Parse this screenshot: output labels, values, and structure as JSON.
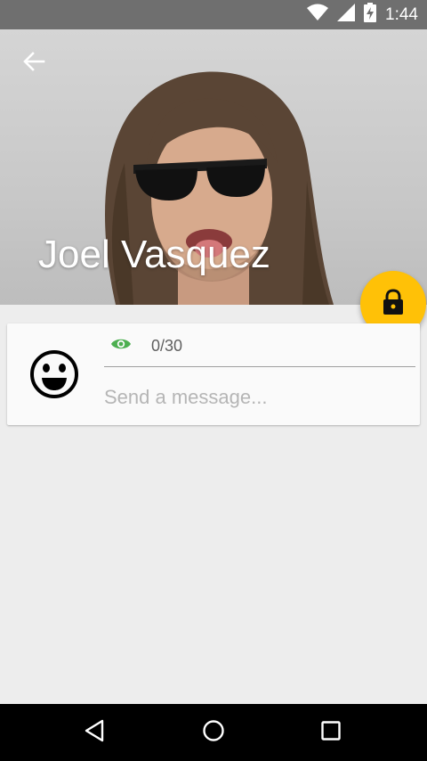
{
  "status_bar": {
    "time": "1:44",
    "icons": [
      "wifi-icon",
      "cell-signal-icon",
      "battery-charging-icon"
    ]
  },
  "header": {
    "contact_name": "Joel Vasquez",
    "back_icon": "arrow-back-icon",
    "photo": "contact-photo"
  },
  "fab": {
    "icon": "lock-icon",
    "color": "#ffc107"
  },
  "composer": {
    "emoji_icon": "smiley-face-icon",
    "visibility_icon": "eye-icon",
    "visibility_color": "#4caf50",
    "counter": "0/30",
    "placeholder": "Send a message...",
    "value": ""
  },
  "nav_bar": {
    "items": [
      "back-triangle-icon",
      "home-circle-icon",
      "recents-square-icon"
    ]
  }
}
